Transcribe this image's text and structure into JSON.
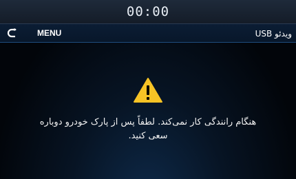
{
  "status_bar": {
    "clock": "00:00"
  },
  "title_bar": {
    "back_icon": "back-arrow-icon",
    "menu_label": "MENU",
    "title": "ویدئو USB"
  },
  "content": {
    "icon": "warning-icon",
    "icon_color": "#f7c325",
    "message": "هنگام رانندگی کار نمی‌کند. لطفاً پس از پارک خودرو دوباره سعی کنید."
  },
  "colors": {
    "accent": "#1f4e80",
    "background": "#02050a"
  }
}
